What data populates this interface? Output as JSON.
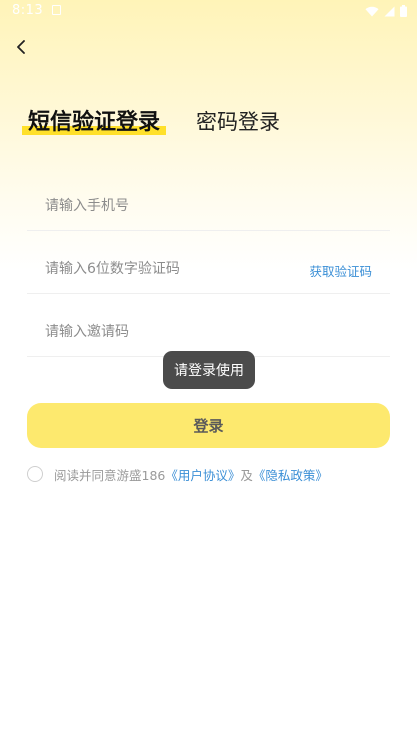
{
  "status_bar": {
    "time": "8:13"
  },
  "tabs": {
    "sms_login": "短信验证登录",
    "password_login": "密码登录"
  },
  "form": {
    "phone_placeholder": "请输入手机号",
    "code_placeholder": "请输入6位数字验证码",
    "get_code_label": "获取验证码",
    "invite_placeholder": "请输入邀请码"
  },
  "toast": {
    "message": "请登录使用"
  },
  "login_button": "登录",
  "agreement": {
    "prefix": "阅读并同意游盛186",
    "user_agreement": "《用户协议》",
    "and": "及",
    "privacy_policy": "《隐私政策》"
  },
  "colors": {
    "accent_yellow": "#ffe02a",
    "button_yellow": "#fde96e",
    "link_blue": "#3b8fd6",
    "toast_bg": "#3c3c3c"
  },
  "icons": [
    "notification-icon",
    "wifi-icon",
    "signal-icon",
    "battery-icon",
    "back-arrow-icon",
    "radio-unchecked-icon"
  ]
}
